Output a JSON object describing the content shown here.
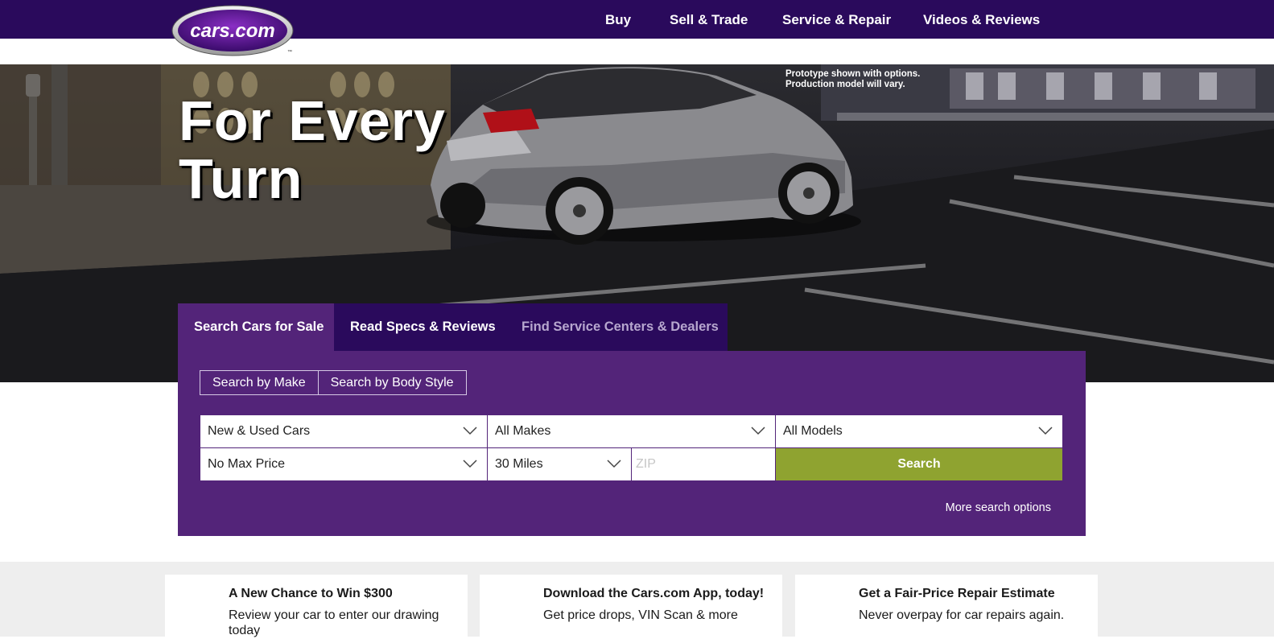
{
  "brand": {
    "logo_text": "cars.com",
    "logo_tm": "™"
  },
  "nav": {
    "items": [
      {
        "label": "Buy"
      },
      {
        "label": "Sell & Trade"
      },
      {
        "label": "Service & Repair"
      },
      {
        "label": "Videos & Reviews"
      }
    ]
  },
  "hero": {
    "title_line1": "For Every",
    "title_line2": "Turn",
    "disclaimer_line1": "Prototype shown with options.",
    "disclaimer_line2": "Production model will vary."
  },
  "search": {
    "tabs": [
      {
        "label": "Search Cars for Sale",
        "active": true
      },
      {
        "label": "Read Specs & Reviews",
        "active": false
      },
      {
        "label": "Find Service Centers & Dealers",
        "active": false
      }
    ],
    "modes": [
      {
        "label": "Search by Make"
      },
      {
        "label": "Search by Body Style"
      }
    ],
    "stock_type": "New & Used Cars",
    "make": "All Makes",
    "model": "All Models",
    "max_price": "No Max Price",
    "distance": "30 Miles",
    "zip_placeholder": "ZIP",
    "search_label": "Search",
    "more_options": "More search options"
  },
  "promos": [
    {
      "title": "A New Chance to Win $300",
      "text": "Review your car to enter our drawing today"
    },
    {
      "title": "Download the Cars.com App, today!",
      "text": "Get price drops, VIN Scan & more"
    },
    {
      "title": "Get a Fair-Price Repair Estimate",
      "text": "Never overpay for car repairs again."
    }
  ],
  "colors": {
    "nav_bg": "#2a0a5c",
    "panel_bg": "#532479",
    "search_button": "#8fa330"
  }
}
